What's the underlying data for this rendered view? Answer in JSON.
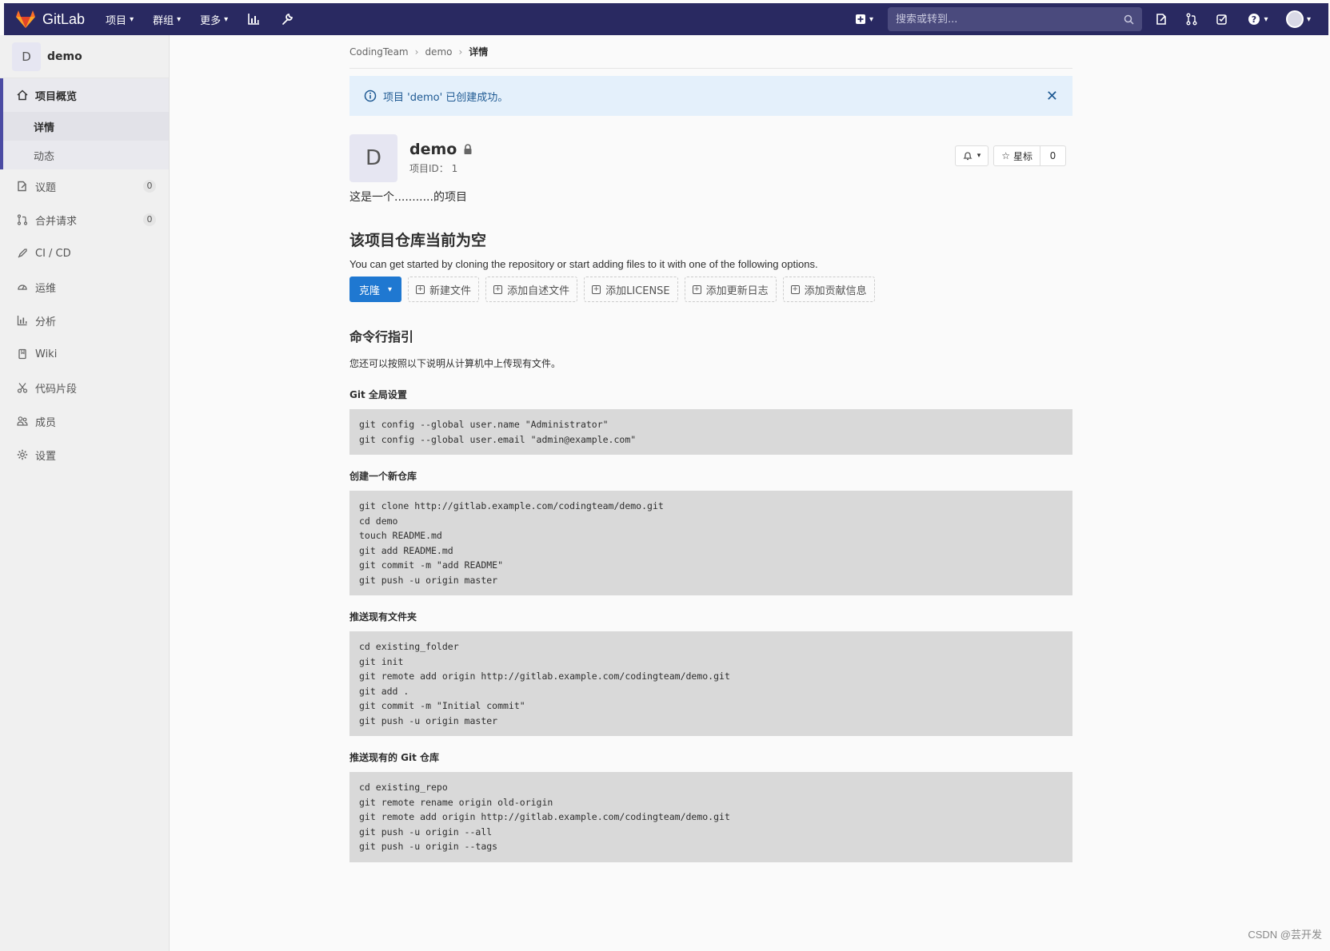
{
  "topbar": {
    "brand": "GitLab",
    "nav": [
      {
        "label": "项目"
      },
      {
        "label": "群组"
      },
      {
        "label": "更多"
      }
    ],
    "search_placeholder": "搜索或转到..."
  },
  "sidebar": {
    "project_initial": "D",
    "project_name": "demo",
    "overview_label": "项目概览",
    "overview_sub": [
      "详情",
      "动态"
    ],
    "items": [
      {
        "label": "议题",
        "count": "0"
      },
      {
        "label": "合并请求",
        "count": "0"
      },
      {
        "label": "CI / CD"
      },
      {
        "label": "运维"
      },
      {
        "label": "分析"
      },
      {
        "label": "Wiki"
      },
      {
        "label": "代码片段"
      },
      {
        "label": "成员"
      },
      {
        "label": "设置"
      }
    ]
  },
  "breadcrumb": [
    "CodingTeam",
    "demo",
    "详情"
  ],
  "flash": "项目 'demo' 已创建成功。",
  "project": {
    "initial": "D",
    "name": "demo",
    "id_label": "项目ID：  1",
    "star_label": "星标",
    "star_count": "0",
    "description": "这是一个...........的项目"
  },
  "empty": {
    "title": "该项目仓库当前为空",
    "desc": "You can get started by cloning the repository or start adding files to it with one of the following options.",
    "clone_label": "克隆",
    "buttons": [
      "新建文件",
      "添加自述文件",
      "添加LICENSE",
      "添加更新日志",
      "添加贡献信息"
    ]
  },
  "cli": {
    "title": "命令行指引",
    "desc": "您还可以按照以下说明从计算机中上传现有文件。",
    "sections": [
      {
        "title": "Git 全局设置",
        "code": "git config --global user.name \"Administrator\"\ngit config --global user.email \"admin@example.com\""
      },
      {
        "title": "创建一个新仓库",
        "code": "git clone http://gitlab.example.com/codingteam/demo.git\ncd demo\ntouch README.md\ngit add README.md\ngit commit -m \"add README\"\ngit push -u origin master"
      },
      {
        "title": "推送现有文件夹",
        "code": "cd existing_folder\ngit init\ngit remote add origin http://gitlab.example.com/codingteam/demo.git\ngit add .\ngit commit -m \"Initial commit\"\ngit push -u origin master"
      },
      {
        "title": "推送现有的 Git 仓库",
        "code": "cd existing_repo\ngit remote rename origin old-origin\ngit remote add origin http://gitlab.example.com/codingteam/demo.git\ngit push -u origin --all\ngit push -u origin --tags"
      }
    ]
  },
  "watermark": "CSDN @芸开发"
}
